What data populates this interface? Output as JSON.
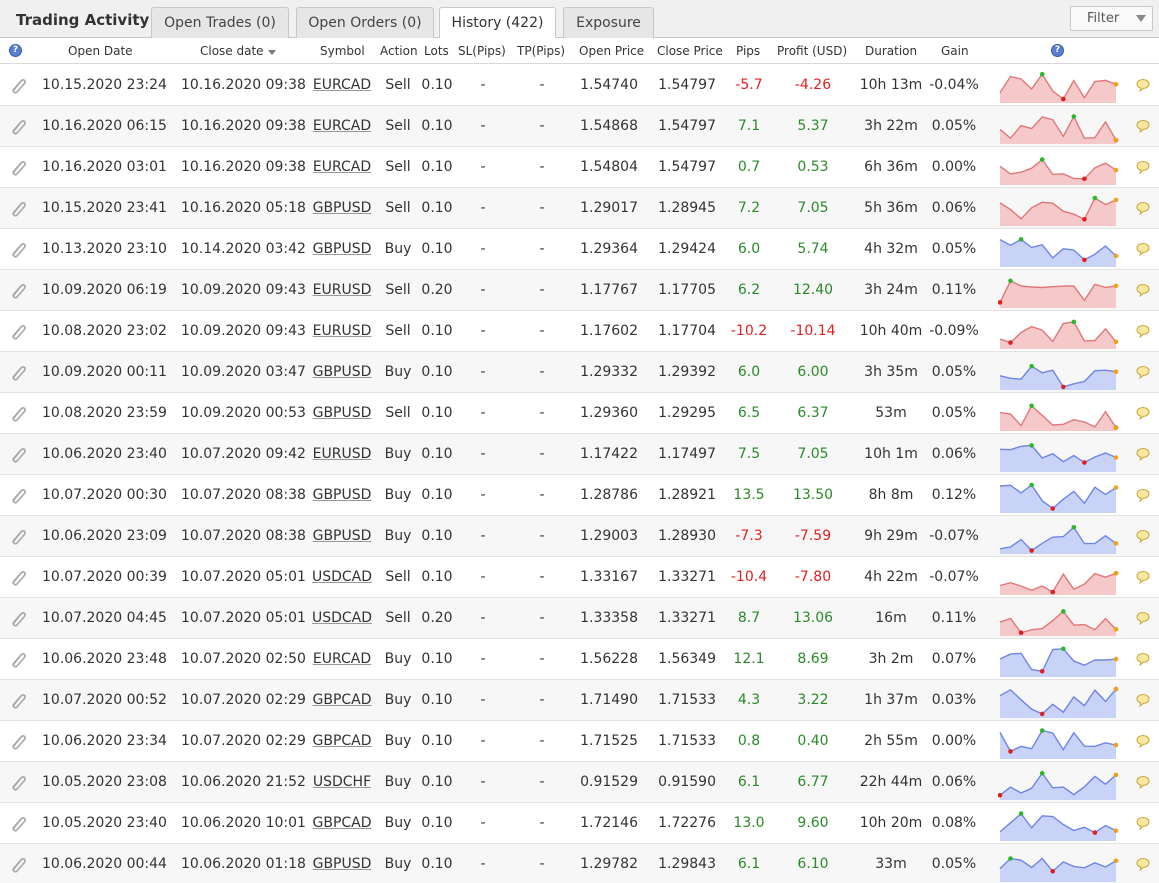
{
  "header": {
    "title": "Trading Activity",
    "tabs": [
      {
        "label": "Open Trades (0)",
        "active": false
      },
      {
        "label": "Open Orders (0)",
        "active": false
      },
      {
        "label": "History (422)",
        "active": true
      },
      {
        "label": "Exposure",
        "active": false
      }
    ],
    "filter_label": "Filter"
  },
  "columns": {
    "open_date": "Open Date",
    "close_date": "Close date",
    "symbol": "Symbol",
    "action": "Action",
    "lots": "Lots",
    "sl": "SL(Pips)",
    "tp": "TP(Pips)",
    "open_price": "Open Price",
    "close_price": "Close Price",
    "pips": "Pips",
    "profit": "Profit (USD)",
    "duration": "Duration",
    "gain": "Gain",
    "help_icon": "?"
  },
  "colors": {
    "positive": "#2a8a2a",
    "negative": "#e02020",
    "buy_fill": "#c9d3f7",
    "buy_line": "#6f85e8",
    "sell_fill": "#f5c9c9",
    "sell_line": "#e07878"
  },
  "icons": {
    "attach": "paperclip-icon",
    "comment": "speech-bubble-icon",
    "help": "help-icon",
    "sort": "sort-desc-icon"
  },
  "rows": [
    {
      "open_date": "10.15.2020 23:24",
      "close_date": "10.16.2020 09:38",
      "symbol": "EURCAD",
      "action": "Sell",
      "lots": "0.10",
      "sl": "-",
      "tp": "-",
      "open_price": "1.54740",
      "close_price": "1.54797",
      "pips": "-5.7",
      "profit": "-4.26",
      "duration": "10h 13m",
      "gain": "-0.04%"
    },
    {
      "open_date": "10.16.2020 06:15",
      "close_date": "10.16.2020 09:38",
      "symbol": "EURCAD",
      "action": "Sell",
      "lots": "0.10",
      "sl": "-",
      "tp": "-",
      "open_price": "1.54868",
      "close_price": "1.54797",
      "pips": "7.1",
      "profit": "5.37",
      "duration": "3h 22m",
      "gain": "0.05%"
    },
    {
      "open_date": "10.16.2020 03:01",
      "close_date": "10.16.2020 09:38",
      "symbol": "EURCAD",
      "action": "Sell",
      "lots": "0.10",
      "sl": "-",
      "tp": "-",
      "open_price": "1.54804",
      "close_price": "1.54797",
      "pips": "0.7",
      "profit": "0.53",
      "duration": "6h 36m",
      "gain": "0.00%"
    },
    {
      "open_date": "10.15.2020 23:41",
      "close_date": "10.16.2020 05:18",
      "symbol": "GBPUSD",
      "action": "Sell",
      "lots": "0.10",
      "sl": "-",
      "tp": "-",
      "open_price": "1.29017",
      "close_price": "1.28945",
      "pips": "7.2",
      "profit": "7.05",
      "duration": "5h 36m",
      "gain": "0.06%"
    },
    {
      "open_date": "10.13.2020 23:10",
      "close_date": "10.14.2020 03:42",
      "symbol": "GBPUSD",
      "action": "Buy",
      "lots": "0.10",
      "sl": "-",
      "tp": "-",
      "open_price": "1.29364",
      "close_price": "1.29424",
      "pips": "6.0",
      "profit": "5.74",
      "duration": "4h 32m",
      "gain": "0.05%"
    },
    {
      "open_date": "10.09.2020 06:19",
      "close_date": "10.09.2020 09:43",
      "symbol": "EURUSD",
      "action": "Sell",
      "lots": "0.20",
      "sl": "-",
      "tp": "-",
      "open_price": "1.17767",
      "close_price": "1.17705",
      "pips": "6.2",
      "profit": "12.40",
      "duration": "3h 24m",
      "gain": "0.11%"
    },
    {
      "open_date": "10.08.2020 23:02",
      "close_date": "10.09.2020 09:43",
      "symbol": "EURUSD",
      "action": "Sell",
      "lots": "0.10",
      "sl": "-",
      "tp": "-",
      "open_price": "1.17602",
      "close_price": "1.17704",
      "pips": "-10.2",
      "profit": "-10.14",
      "duration": "10h 40m",
      "gain": "-0.09%"
    },
    {
      "open_date": "10.09.2020 00:11",
      "close_date": "10.09.2020 03:47",
      "symbol": "GBPUSD",
      "action": "Buy",
      "lots": "0.10",
      "sl": "-",
      "tp": "-",
      "open_price": "1.29332",
      "close_price": "1.29392",
      "pips": "6.0",
      "profit": "6.00",
      "duration": "3h 35m",
      "gain": "0.05%"
    },
    {
      "open_date": "10.08.2020 23:59",
      "close_date": "10.09.2020 00:53",
      "symbol": "GBPUSD",
      "action": "Sell",
      "lots": "0.10",
      "sl": "-",
      "tp": "-",
      "open_price": "1.29360",
      "close_price": "1.29295",
      "pips": "6.5",
      "profit": "6.37",
      "duration": "53m",
      "gain": "0.05%"
    },
    {
      "open_date": "10.06.2020 23:40",
      "close_date": "10.07.2020 09:42",
      "symbol": "EURUSD",
      "action": "Buy",
      "lots": "0.10",
      "sl": "-",
      "tp": "-",
      "open_price": "1.17422",
      "close_price": "1.17497",
      "pips": "7.5",
      "profit": "7.05",
      "duration": "10h 1m",
      "gain": "0.06%"
    },
    {
      "open_date": "10.07.2020 00:30",
      "close_date": "10.07.2020 08:38",
      "symbol": "GBPUSD",
      "action": "Buy",
      "lots": "0.10",
      "sl": "-",
      "tp": "-",
      "open_price": "1.28786",
      "close_price": "1.28921",
      "pips": "13.5",
      "profit": "13.50",
      "duration": "8h 8m",
      "gain": "0.12%"
    },
    {
      "open_date": "10.06.2020 23:09",
      "close_date": "10.07.2020 08:38",
      "symbol": "GBPUSD",
      "action": "Buy",
      "lots": "0.10",
      "sl": "-",
      "tp": "-",
      "open_price": "1.29003",
      "close_price": "1.28930",
      "pips": "-7.3",
      "profit": "-7.59",
      "duration": "9h 29m",
      "gain": "-0.07%"
    },
    {
      "open_date": "10.07.2020 00:39",
      "close_date": "10.07.2020 05:01",
      "symbol": "USDCAD",
      "action": "Sell",
      "lots": "0.10",
      "sl": "-",
      "tp": "-",
      "open_price": "1.33167",
      "close_price": "1.33271",
      "pips": "-10.4",
      "profit": "-7.80",
      "duration": "4h 22m",
      "gain": "-0.07%"
    },
    {
      "open_date": "10.07.2020 04:45",
      "close_date": "10.07.2020 05:01",
      "symbol": "USDCAD",
      "action": "Sell",
      "lots": "0.20",
      "sl": "-",
      "tp": "-",
      "open_price": "1.33358",
      "close_price": "1.33271",
      "pips": "8.7",
      "profit": "13.06",
      "duration": "16m",
      "gain": "0.11%"
    },
    {
      "open_date": "10.06.2020 23:48",
      "close_date": "10.07.2020 02:50",
      "symbol": "EURCAD",
      "action": "Buy",
      "lots": "0.10",
      "sl": "-",
      "tp": "-",
      "open_price": "1.56228",
      "close_price": "1.56349",
      "pips": "12.1",
      "profit": "8.69",
      "duration": "3h 2m",
      "gain": "0.07%"
    },
    {
      "open_date": "10.07.2020 00:52",
      "close_date": "10.07.2020 02:29",
      "symbol": "GBPCAD",
      "action": "Buy",
      "lots": "0.10",
      "sl": "-",
      "tp": "-",
      "open_price": "1.71490",
      "close_price": "1.71533",
      "pips": "4.3",
      "profit": "3.22",
      "duration": "1h 37m",
      "gain": "0.03%"
    },
    {
      "open_date": "10.06.2020 23:34",
      "close_date": "10.07.2020 02:29",
      "symbol": "GBPCAD",
      "action": "Buy",
      "lots": "0.10",
      "sl": "-",
      "tp": "-",
      "open_price": "1.71525",
      "close_price": "1.71533",
      "pips": "0.8",
      "profit": "0.40",
      "duration": "2h 55m",
      "gain": "0.00%"
    },
    {
      "open_date": "10.05.2020 23:08",
      "close_date": "10.06.2020 21:52",
      "symbol": "USDCHF",
      "action": "Buy",
      "lots": "0.10",
      "sl": "-",
      "tp": "-",
      "open_price": "0.91529",
      "close_price": "0.91590",
      "pips": "6.1",
      "profit": "6.77",
      "duration": "22h 44m",
      "gain": "0.06%"
    },
    {
      "open_date": "10.05.2020 23:40",
      "close_date": "10.06.2020 10:01",
      "symbol": "GBPCAD",
      "action": "Buy",
      "lots": "0.10",
      "sl": "-",
      "tp": "-",
      "open_price": "1.72146",
      "close_price": "1.72276",
      "pips": "13.0",
      "profit": "9.60",
      "duration": "10h 20m",
      "gain": "0.08%"
    },
    {
      "open_date": "10.06.2020 00:44",
      "close_date": "10.06.2020 01:18",
      "symbol": "GBPUSD",
      "action": "Buy",
      "lots": "0.10",
      "sl": "-",
      "tp": "-",
      "open_price": "1.29782",
      "close_price": "1.29843",
      "pips": "6.1",
      "profit": "6.10",
      "duration": "33m",
      "gain": "0.05%"
    }
  ]
}
